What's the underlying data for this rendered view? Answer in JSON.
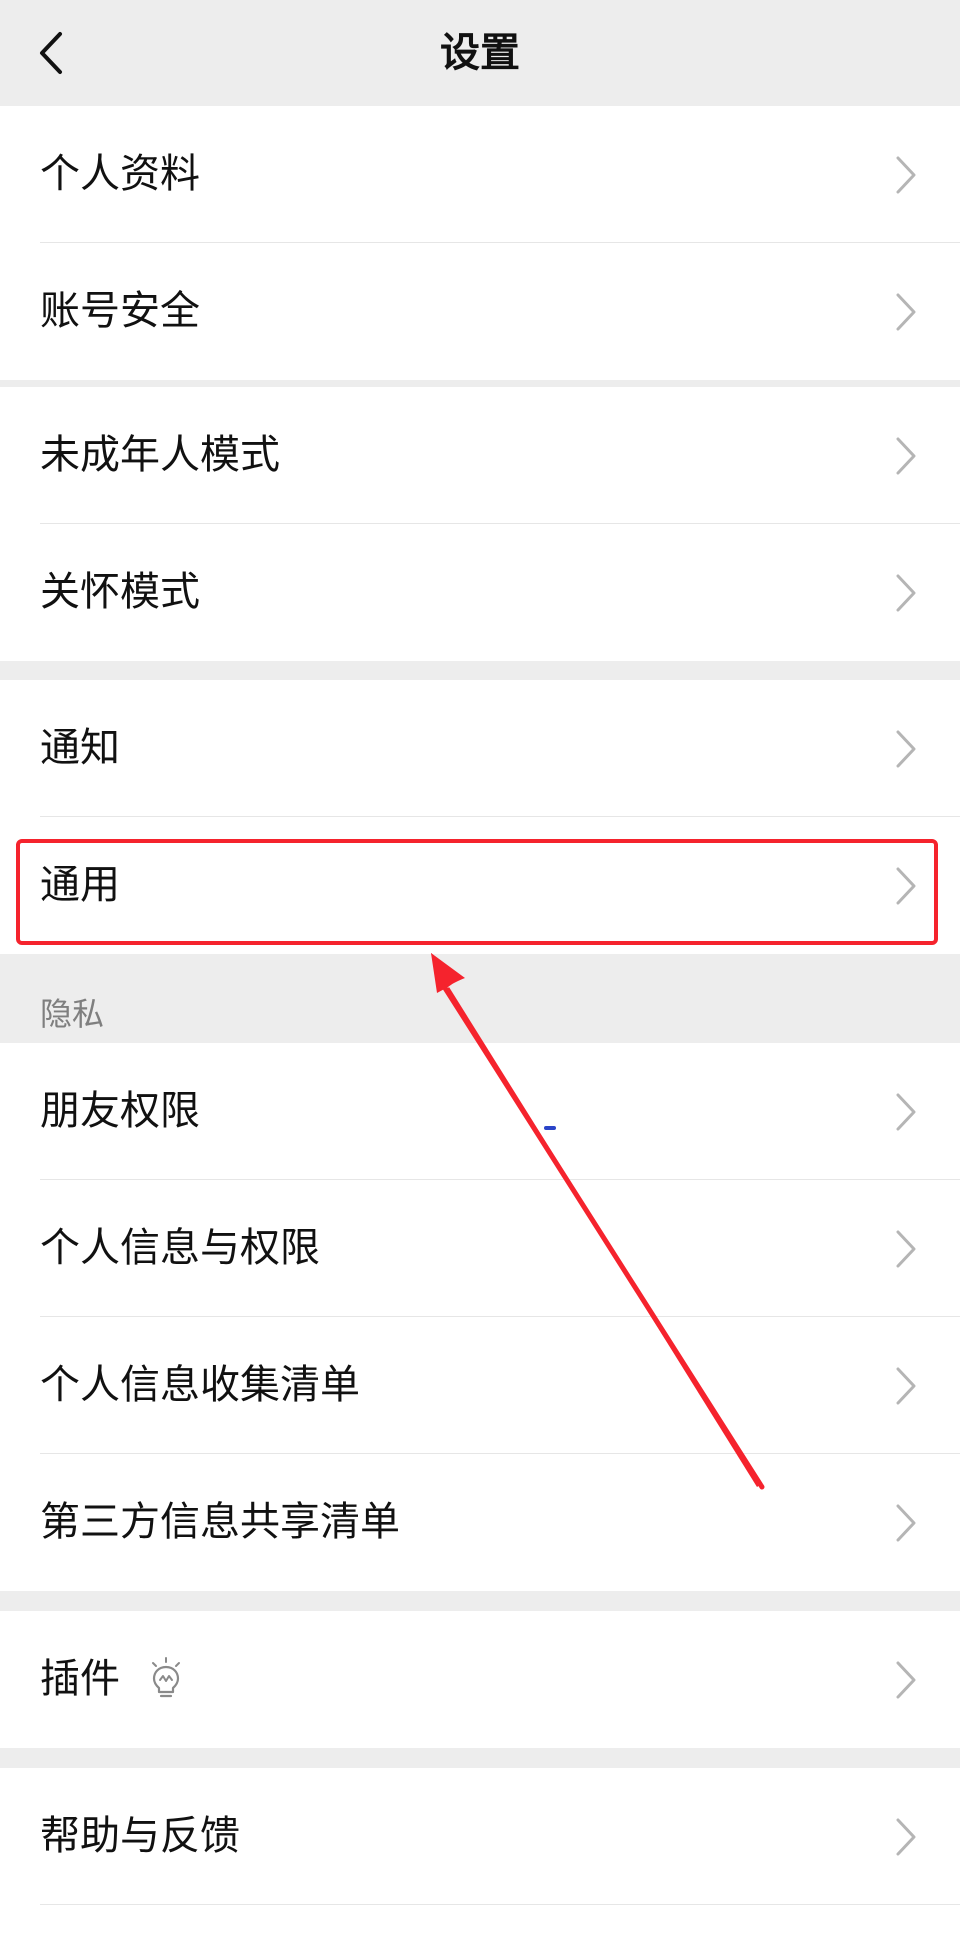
{
  "header": {
    "title": "设置",
    "back_icon": "chevron-left-icon"
  },
  "groups": [
    {
      "items": [
        {
          "label": "个人资料"
        },
        {
          "label": "账号安全"
        }
      ]
    },
    {
      "items": [
        {
          "label": "未成年人模式"
        },
        {
          "label": "关怀模式"
        }
      ]
    },
    {
      "items": [
        {
          "label": "通知"
        },
        {
          "label": "通用"
        }
      ]
    },
    {
      "items": [
        {
          "label": "朋友权限"
        },
        {
          "label": "个人信息与权限"
        },
        {
          "label": "个人信息收集清单"
        },
        {
          "label": "第三方信息共享清单"
        }
      ]
    },
    {
      "items": [
        {
          "label": "插件",
          "icon": "lightbulb-icon"
        }
      ]
    },
    {
      "items": [
        {
          "label": "帮助与反馈"
        }
      ]
    }
  ],
  "sections": {
    "privacy_header": "隐私"
  },
  "annotation": {
    "highlighted_item": "通用",
    "highlight_color": "#f5232d",
    "arrow_color": "#f5232d"
  }
}
